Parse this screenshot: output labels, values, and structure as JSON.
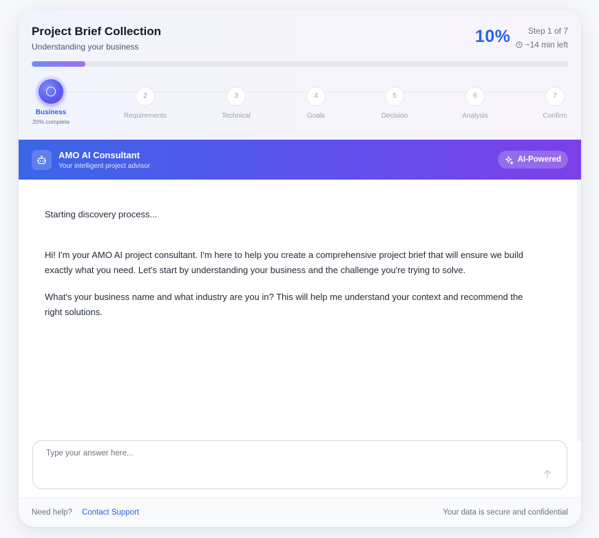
{
  "header": {
    "title": "Project Brief Collection",
    "subtitle": "Understanding your business",
    "percent": "10%",
    "step_label": "Step 1 of 7",
    "time_left": "~14 min left",
    "progress": 0.1
  },
  "stepper": {
    "active_complete": "20% complete",
    "steps": [
      {
        "number": "",
        "label": "Business"
      },
      {
        "number": "2",
        "label": "Requirements"
      },
      {
        "number": "3",
        "label": "Technical"
      },
      {
        "number": "4",
        "label": "Goals"
      },
      {
        "number": "5",
        "label": "Decision"
      },
      {
        "number": "6",
        "label": "Analysis"
      },
      {
        "number": "7",
        "label": "Confirm"
      }
    ]
  },
  "banner": {
    "title": "AMO AI Consultant",
    "subtitle": "Your intelligent project advisor",
    "badge": "AI-Powered"
  },
  "chat": {
    "status": "Starting discovery process...",
    "message_1": "Hi! I'm your AMO AI project consultant. I'm here to help you create a comprehensive project brief that will ensure we build exactly what you need. Let's start by understanding your business and the challenge you're trying to solve.",
    "message_2": "What's your business name and what industry are you in? This will help me understand your context and recommend the right solutions.",
    "input_placeholder": "Type your answer here...",
    "input_value": ""
  },
  "footer": {
    "help": "Need help?",
    "support_link": "Contact Support",
    "secure": "Your data is secure and confidential"
  },
  "colors": {
    "accent": "#2563eb",
    "banner_start": "#3a66e8",
    "banner_end": "#7d3fe8",
    "progress_start": "#6b8ef5",
    "progress_end": "#a66cf2"
  },
  "icons": {
    "clock": "clock-icon",
    "bot": "bot-icon",
    "sparkle": "sparkles-icon",
    "send": "arrow-up-icon"
  }
}
